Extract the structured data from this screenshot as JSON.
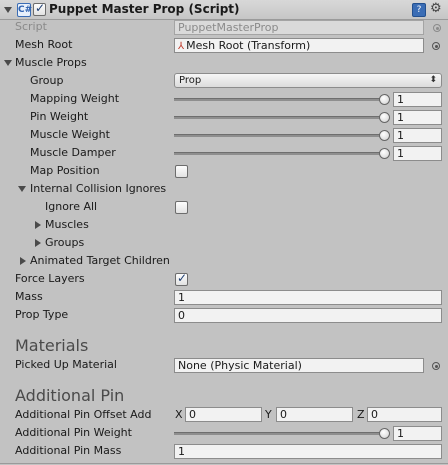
{
  "header": {
    "title": "Puppet Master Prop (Script)",
    "component_icon": "C#",
    "help_icon": "help-icon",
    "gear_icon": "gear-icon"
  },
  "script": {
    "label": "Script",
    "value": "PuppetMasterProp"
  },
  "mesh_root": {
    "label": "Mesh Root",
    "value": "Mesh Root (Transform)"
  },
  "muscle_props": {
    "label": "Muscle Props",
    "group": {
      "label": "Group",
      "value": "Prop"
    },
    "mapping_weight": {
      "label": "Mapping Weight",
      "value": "1",
      "level": 1.0
    },
    "pin_weight": {
      "label": "Pin Weight",
      "value": "1",
      "level": 1.0
    },
    "muscle_weight": {
      "label": "Muscle Weight",
      "value": "1",
      "level": 1.0
    },
    "muscle_damper": {
      "label": "Muscle Damper",
      "value": "1",
      "level": 1.0
    },
    "map_position": {
      "label": "Map Position",
      "checked": false
    },
    "internal_collision_ignores": {
      "label": "Internal Collision Ignores",
      "ignore_all": {
        "label": "Ignore All",
        "checked": false
      },
      "muscles": "Muscles",
      "groups": "Groups"
    },
    "animated_target_children": "Animated Target Children"
  },
  "force_layers": {
    "label": "Force Layers",
    "checked": true
  },
  "mass": {
    "label": "Mass",
    "value": "1"
  },
  "prop_type": {
    "label": "Prop Type",
    "value": "0"
  },
  "materials": {
    "title": "Materials",
    "picked_up_material": {
      "label": "Picked Up Material",
      "value": "None (Physic Material)"
    }
  },
  "additional_pin": {
    "title": "Additional Pin",
    "offset": {
      "label": "Additional Pin Offset Add",
      "x_label": "X",
      "x": "0",
      "y_label": "Y",
      "y": "0",
      "z_label": "Z",
      "z": "0"
    },
    "weight": {
      "label": "Additional Pin Weight",
      "value": "1",
      "level": 1.0
    },
    "mass": {
      "label": "Additional Pin Mass",
      "value": "1"
    }
  }
}
